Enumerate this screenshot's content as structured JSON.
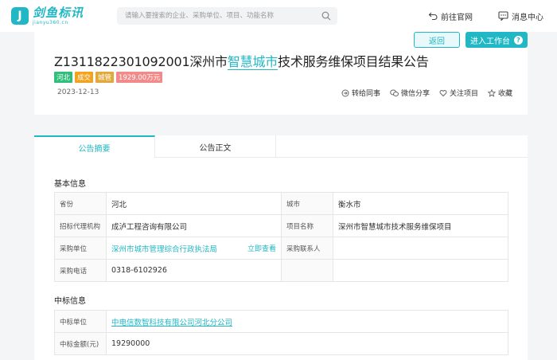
{
  "header": {
    "logo_main": "剑鱼标讯",
    "logo_sub": "jianyu360.cn",
    "search_placeholder": "请输入要搜索的企业、采购单位、项目、功能名称",
    "site_link": "前往官网",
    "message_link": "消息中心"
  },
  "toolbar": {
    "back_label": "返回",
    "workbench_label": "进入工作台"
  },
  "announcement": {
    "title_prefix": "Z1311822301092001深州市",
    "title_highlight": "智慧城市",
    "title_suffix": "技术服务维保项目结果公告",
    "tags": [
      "河北",
      "成交",
      "城管",
      "1929.00万元"
    ],
    "date": "2023-12-13",
    "actions": {
      "forward": "转给同事",
      "wechat": "微信分享",
      "follow": "关注项目",
      "collect": "收藏"
    }
  },
  "tabs": [
    "公告摘要",
    "公告正文"
  ],
  "basic_info": {
    "title": "基本信息",
    "rows": [
      {
        "k1": "省份",
        "v1": "河北",
        "k2": "城市",
        "v2": "衡水市"
      },
      {
        "k1": "招标代理机构",
        "v1": "成泸工程咨询有限公司",
        "k2": "项目名称",
        "v2": "深州市智慧城市技术服务维保项目"
      },
      {
        "k1": "采购单位",
        "v1": "深州市城市管理综合行政执法局",
        "view": "立即查看",
        "k2": "采购联系人",
        "v2": ""
      },
      {
        "k1": "采购电话",
        "v1": "0318-6102926",
        "k2": "",
        "v2": ""
      }
    ]
  },
  "winner_info": {
    "title": "中标信息",
    "rows": [
      {
        "k": "中标单位",
        "v": "中电信数智科技有限公司河北分公司"
      },
      {
        "k": "中标金额(元)",
        "v": "19290000"
      }
    ]
  }
}
